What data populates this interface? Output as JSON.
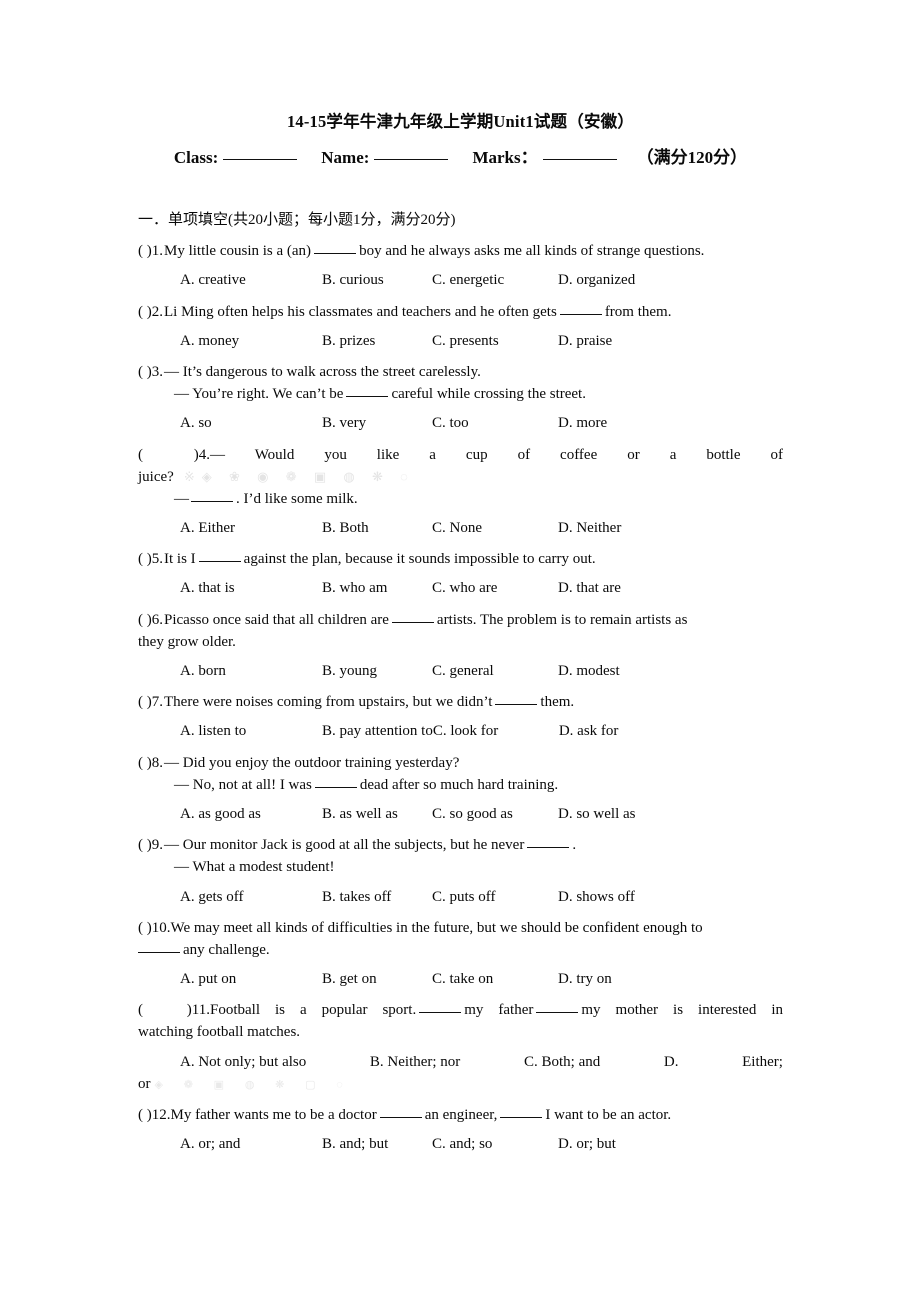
{
  "document": {
    "title": "14-15学年牛津九年级上学期Unit1试题（安徽）",
    "identity": {
      "class_label": "Class:",
      "name_label": "Name:",
      "marks_label": "Marks：",
      "total_note": "（满分120分）"
    },
    "section_heading": "一．单项填空(共20小题；每小题1分，满分20分)",
    "watermark_primary": "※◈ ❀ ◉ ❁ ▣ ◍ ❋ ◌",
    "watermark_secondary": "◈ ❁ ▣ ◍ ❋ ▢ ◌"
  },
  "questions": [
    {
      "number": "1",
      "marker": "(     )1.",
      "stem_pre": "My little cousin is a (an)",
      "stem_post": "boy and he always asks me all kinds of strange questions.",
      "options": [
        "A. creative",
        "B. curious",
        "C. energetic",
        "D. organized"
      ]
    },
    {
      "number": "2",
      "marker": "(     )2.",
      "stem_pre": "Li Ming often helps his classmates and teachers and he often gets",
      "stem_post": "from them.",
      "options": [
        "A. money",
        "B. prizes",
        "C. presents",
        "D. praise"
      ]
    },
    {
      "number": "3",
      "marker": "(     )3.",
      "stem_line1": "— It’s dangerous to walk across the street carelessly.",
      "stem_pre": "— You’re right. We can’t be",
      "stem_post": "careful while crossing the street.",
      "options": [
        "A. so",
        "B. very",
        "C. too",
        "D. more"
      ]
    },
    {
      "number": "4",
      "marker": "(             )4.",
      "stem_line1": "—  Would  you  like  a  cup  of  coffee  or  a  bottle  of",
      "stem_line2": "juice?",
      "stem_pre": "—",
      "stem_post": ". I’d like some milk.",
      "options": [
        "A. Either",
        "B. Both",
        "C. None",
        "D. Neither"
      ]
    },
    {
      "number": "5",
      "marker": "(     )5.",
      "stem_pre": "It is I",
      "stem_post": "against the plan, because it sounds impossible to carry out.",
      "options": [
        "A. that is",
        "B. who am",
        "C. who are",
        "D. that are"
      ]
    },
    {
      "number": "6",
      "marker": "(     )6.",
      "stem_pre": "Picasso once said that all children are",
      "stem_post": "artists. The problem is to remain artists as",
      "stem_wrap": "they grow older.",
      "options": [
        "A. born",
        "B. young",
        "C. general",
        "D. modest"
      ]
    },
    {
      "number": "7",
      "marker": "(     )7.",
      "stem_pre": "There were noises coming from upstairs, but we didn’t",
      "stem_post": "them.",
      "options": [
        "A. listen to",
        "B. pay attention to",
        "C. look for",
        "D. ask for"
      ]
    },
    {
      "number": "8",
      "marker": "(     )8.",
      "stem_line1": "— Did you enjoy the outdoor training yesterday?",
      "stem_pre": "— No, not at all! I was",
      "stem_post": "dead after so much hard training.",
      "options": [
        "A. as good as",
        "B. as well as",
        "C. so good as",
        "D. so well as"
      ]
    },
    {
      "number": "9",
      "marker": "(     )9.",
      "stem_pre": "— Our monitor Jack is good at all the subjects, but he never",
      "stem_post": ".",
      "stem_line2": "— What a modest student!",
      "options": [
        "A. gets off",
        "B. takes off",
        "C. puts off",
        "D. shows off"
      ]
    },
    {
      "number": "10",
      "marker": "(     )10.",
      "stem_pre": "We may meet all kinds of difficulties in the future, but we should be confident enough to",
      "stem_post": "any challenge.",
      "options": [
        "A. put on",
        "B. get on",
        "C. take on",
        "D. try on"
      ]
    },
    {
      "number": "11",
      "marker": "(      )11.",
      "stem_pre": "Football  is  a  popular  sport.",
      "stem_mid": "my  father",
      "stem_post": "my  mother  is  interested  in",
      "stem_wrap": "watching football matches.",
      "options": [
        "A. Not only; but also",
        "B. Neither; nor",
        "C. Both; and",
        "D.",
        "Either;"
      ],
      "options_wrap": "or"
    },
    {
      "number": "12",
      "marker": "(     )12.",
      "stem_pre": "My father wants me to be a doctor",
      "stem_mid": "an engineer,",
      "stem_post": "I want to be an actor.",
      "options": [
        "A. or; and",
        "B. and; but",
        "C. and; so",
        "D. or; but"
      ]
    }
  ]
}
